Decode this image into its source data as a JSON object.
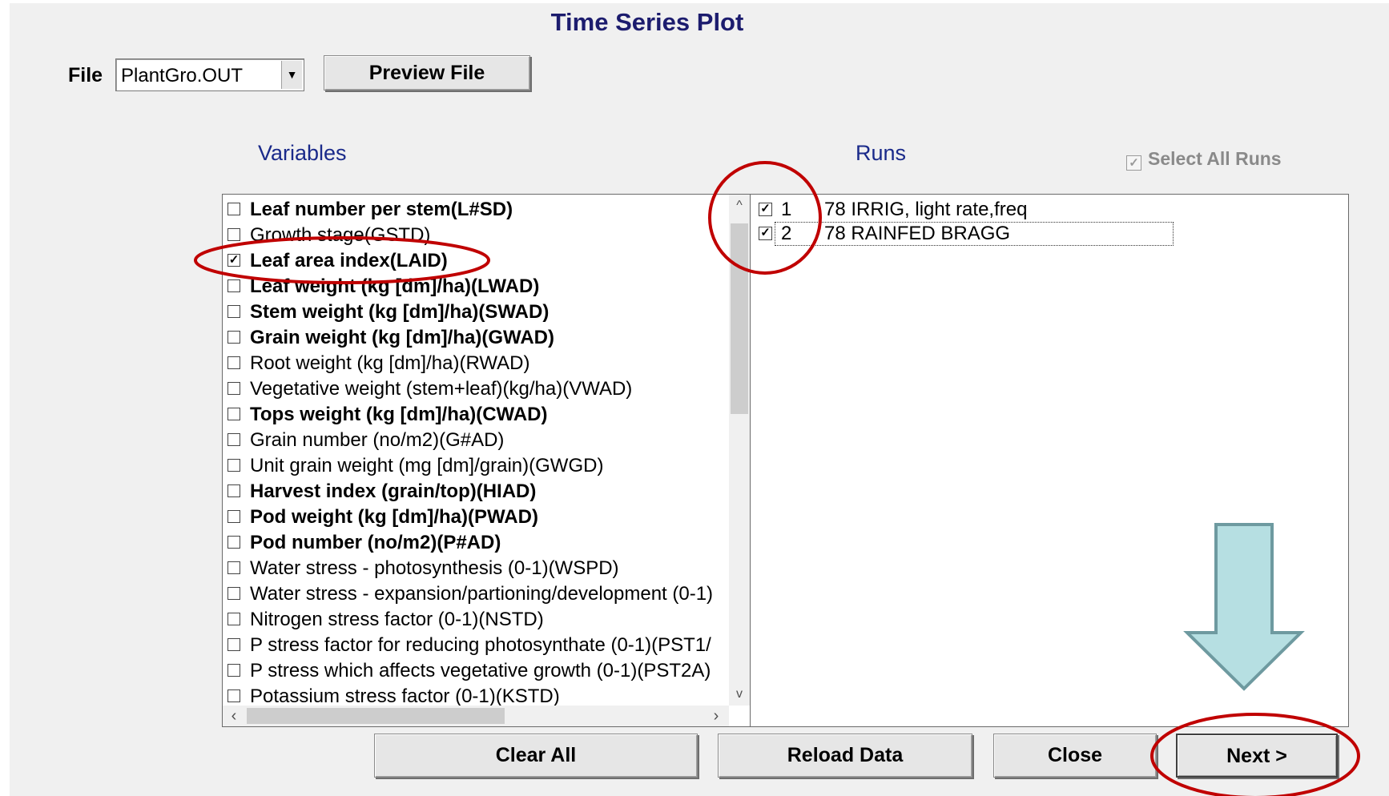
{
  "dialog": {
    "title": "Time Series Plot"
  },
  "file": {
    "label": "File",
    "selected": "PlantGro.OUT",
    "preview_button": "Preview File"
  },
  "variables": {
    "label": "Variables",
    "items": [
      {
        "label": "Leaf number per stem(L#SD)",
        "checked": false,
        "bold": true
      },
      {
        "label": "Growth stage(GSTD)",
        "checked": false,
        "bold": false
      },
      {
        "label": "Leaf area index(LAID)",
        "checked": true,
        "bold": true
      },
      {
        "label": "Leaf weight (kg [dm]/ha)(LWAD)",
        "checked": false,
        "bold": true
      },
      {
        "label": "Stem weight (kg [dm]/ha)(SWAD)",
        "checked": false,
        "bold": true
      },
      {
        "label": "Grain weight (kg [dm]/ha)(GWAD)",
        "checked": false,
        "bold": true
      },
      {
        "label": "Root weight (kg [dm]/ha)(RWAD)",
        "checked": false,
        "bold": false
      },
      {
        "label": "Vegetative weight (stem+leaf)(kg/ha)(VWAD)",
        "checked": false,
        "bold": false
      },
      {
        "label": "Tops weight (kg [dm]/ha)(CWAD)",
        "checked": false,
        "bold": true
      },
      {
        "label": "Grain number (no/m2)(G#AD)",
        "checked": false,
        "bold": false
      },
      {
        "label": "Unit grain weight (mg [dm]/grain)(GWGD)",
        "checked": false,
        "bold": false
      },
      {
        "label": "Harvest index (grain/top)(HIAD)",
        "checked": false,
        "bold": true
      },
      {
        "label": "Pod weight (kg [dm]/ha)(PWAD)",
        "checked": false,
        "bold": true
      },
      {
        "label": "Pod number (no/m2)(P#AD)",
        "checked": false,
        "bold": true
      },
      {
        "label": "Water stress - photosynthesis (0-1)(WSPD)",
        "checked": false,
        "bold": false
      },
      {
        "label": "Water stress - expansion/partioning/development (0-1)",
        "checked": false,
        "bold": false
      },
      {
        "label": "Nitrogen stress factor (0-1)(NSTD)",
        "checked": false,
        "bold": false
      },
      {
        "label": "P stress factor for reducing photosynthate (0-1)(PST1/",
        "checked": false,
        "bold": false
      },
      {
        "label": "P stress which affects vegetative growth (0-1)(PST2A)",
        "checked": false,
        "bold": false
      },
      {
        "label": "Potassium stress factor (0-1)(KSTD)",
        "checked": false,
        "bold": false
      }
    ]
  },
  "runs": {
    "label": "Runs",
    "select_all_label": "Select All Runs",
    "select_all_checked": true,
    "items": [
      {
        "num": "1",
        "name": "78 IRRIG, light rate,freq",
        "checked": true
      },
      {
        "num": "2",
        "name": "78 RAINFED BRAGG",
        "checked": true
      }
    ]
  },
  "buttons": {
    "clear_all": "Clear All",
    "reload_data": "Reload Data",
    "close": "Close",
    "next": "Next >"
  },
  "annotations": {
    "circle_color": "#c00000",
    "arrow_fill": "#b6dfe2",
    "arrow_stroke": "#6e9aa0"
  }
}
